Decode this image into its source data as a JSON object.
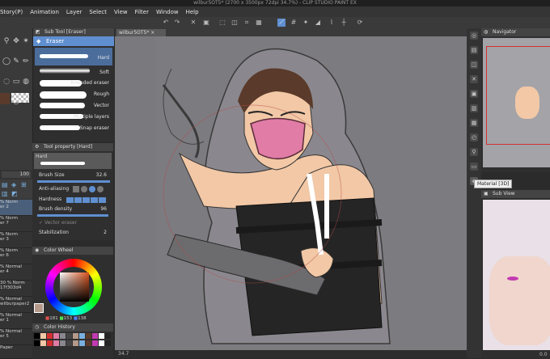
{
  "window": {
    "title": "wilbur5OT5* (2700 x 3500px 72dpi 34.7%) - CLIP STUDIO PAINT EX"
  },
  "menu": [
    "Story(P)",
    "Animation",
    "Layer",
    "Select",
    "View",
    "Filter",
    "Window",
    "Help"
  ],
  "document_tab": {
    "label": "wilbur5OT5*",
    "close": "×"
  },
  "subtool_panel": {
    "title": "Sub Tool [Eraser]",
    "group": "Eraser",
    "items": [
      "Hard",
      "Soft",
      "Kneaded eraser",
      "Rough",
      "Vector",
      "Multiple layers",
      "Snap eraser"
    ]
  },
  "tool_property": {
    "title": "Tool property [Hard]",
    "preset": "Hard",
    "brush_size_label": "Brush Size",
    "brush_size_value": "32.6",
    "anti_aliasing_label": "Anti-aliasing",
    "hardness_label": "Hardness",
    "brush_density_label": "Brush density",
    "brush_density_value": "96",
    "vector_eraser_label": "Vector eraser",
    "stabilization_label": "Stabilization",
    "stabilization_value": "2"
  },
  "color_wheel": {
    "title": "Color Wheel",
    "r": "181",
    "g": "153",
    "b": "138",
    "main_color": "#b5998a"
  },
  "color_history": {
    "title": "Color History"
  },
  "layers": [
    {
      "opacity": "% Norm",
      "name": "er 2"
    },
    {
      "opacity": "% Norm",
      "name": "er 7"
    },
    {
      "opacity": "% Norm",
      "name": "er 3"
    },
    {
      "opacity": "% Norm",
      "name": "er 6"
    },
    {
      "opacity": "% Normal",
      "name": "er 4"
    },
    {
      "opacity": "30 % Norm",
      "name": "17f303d4"
    },
    {
      "opacity": "% Normal",
      "name": "wilburpaper2"
    },
    {
      "opacity": "% Normal",
      "name": "er 1"
    },
    {
      "opacity": "% Normal",
      "name": "er 5"
    },
    {
      "opacity": "",
      "name": "Paper"
    }
  ],
  "layer_size_value": "100",
  "navigator": {
    "title": "Navigator"
  },
  "subview": {
    "title": "Sub View"
  },
  "tooltip": "Material [3D]",
  "status": {
    "zoom": "34.7",
    "sub_zoom": "0.0"
  },
  "colors": {
    "accent": "#5f8fd0",
    "mask": "#e07ca6",
    "hair": "#5a3a2a",
    "skin": "#f2c8a6",
    "shirt": "#252525"
  }
}
